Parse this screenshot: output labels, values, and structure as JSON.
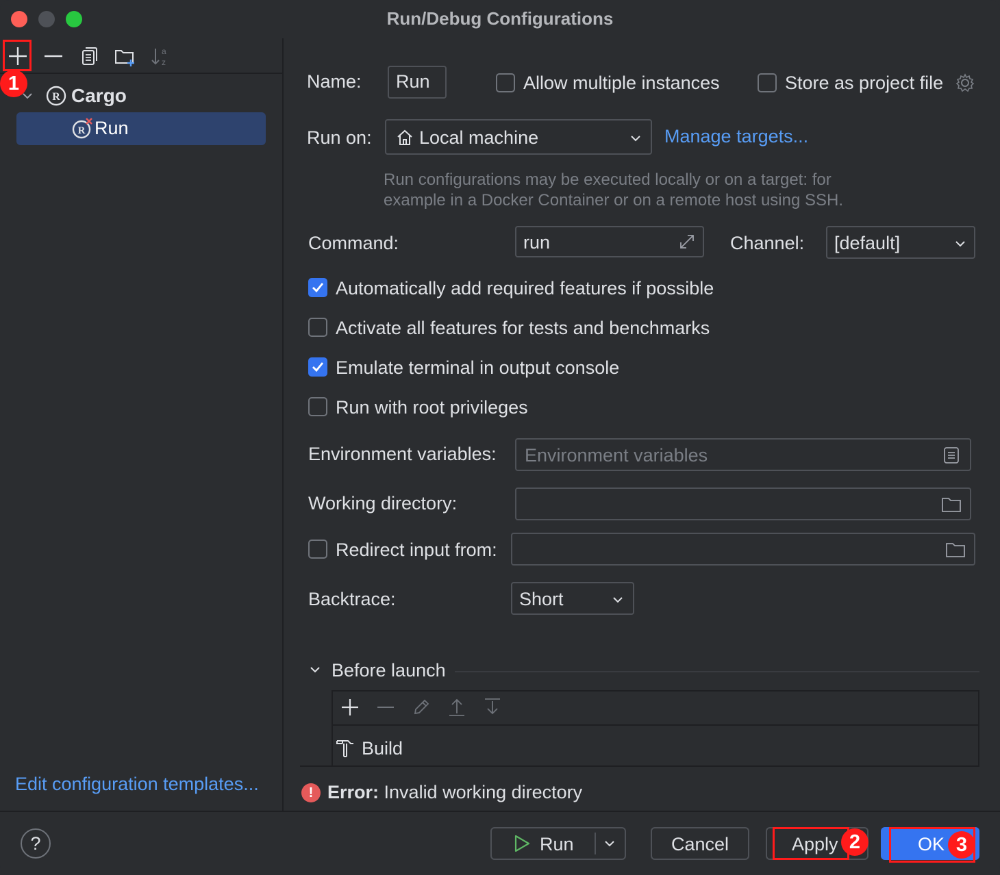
{
  "window": {
    "title": "Run/Debug Configurations"
  },
  "left_toolbar": {
    "items": [
      "add-icon",
      "remove-icon",
      "copy-icon",
      "new-folder-icon",
      "sort-icon"
    ]
  },
  "tree": {
    "group_label": "Cargo",
    "selected_item_label": "Run"
  },
  "edit_templates_link": "Edit configuration templates...",
  "form": {
    "name_label": "Name:",
    "name_value": "Run",
    "allow_multiple_label": "Allow multiple instances",
    "store_project_label": "Store as project file",
    "run_on_label": "Run on:",
    "run_on_value": "Local machine",
    "manage_targets_link": "Manage targets...",
    "run_on_hint_line1": "Run configurations may be executed locally or on a target: for",
    "run_on_hint_line2": "example in a Docker Container or on a remote host using SSH.",
    "command_label": "Command:",
    "command_value": "run",
    "channel_label": "Channel:",
    "channel_value": "[default]",
    "checkbox_auto_features": {
      "label": "Automatically add required features if possible",
      "checked": true
    },
    "checkbox_all_features": {
      "label": "Activate all features for tests and benchmarks",
      "checked": false
    },
    "checkbox_emulate_terminal": {
      "label": "Emulate terminal in output console",
      "checked": true
    },
    "checkbox_root": {
      "label": "Run with root privileges",
      "checked": false
    },
    "env_label": "Environment variables:",
    "env_placeholder": "Environment variables",
    "workdir_label": "Working directory:",
    "workdir_value": "",
    "redirect_label": "Redirect input from:",
    "redirect_checked": false,
    "backtrace_label": "Backtrace:",
    "backtrace_value": "Short"
  },
  "before_launch": {
    "title": "Before launch",
    "items": [
      "Build"
    ]
  },
  "error": {
    "prefix": "Error:",
    "message": "Invalid working directory"
  },
  "buttons": {
    "help": "?",
    "run": "Run",
    "cancel": "Cancel",
    "apply": "Apply",
    "ok": "OK"
  },
  "annotations": {
    "badge1": "1",
    "badge2": "2",
    "badge3": "3"
  },
  "colors": {
    "accent": "#3574f0",
    "link": "#589df6",
    "highlight": "#ff1b1b",
    "error": "#e55a5a",
    "selection": "#2e436e"
  }
}
